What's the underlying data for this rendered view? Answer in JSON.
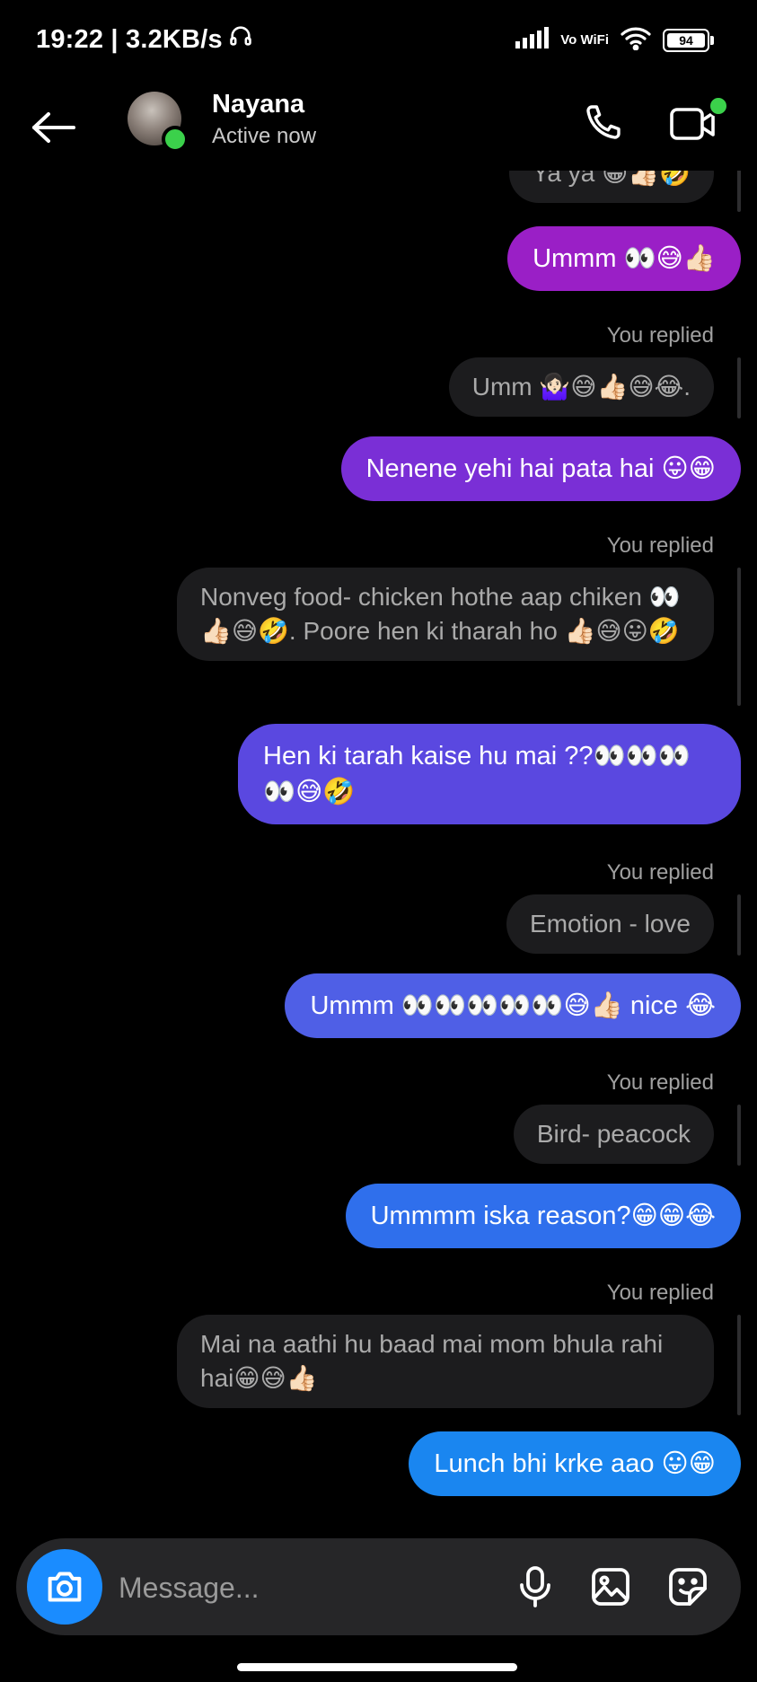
{
  "status_bar": {
    "time_speed": "19:22 | 3.2KB/s",
    "network_label": "Vo WiFi",
    "battery": "94"
  },
  "header": {
    "contact_name": "Nayana",
    "contact_status": "Active now"
  },
  "messages": [
    {
      "type": "quote",
      "text": "Ya ya 😁👍🏻🤣"
    },
    {
      "type": "sent",
      "text": "Ummm 👀😅👍🏻"
    },
    {
      "type": "label",
      "text": "You replied"
    },
    {
      "type": "quote",
      "text": "Umm 🤷🏻‍♀️😅👍🏻😅😂."
    },
    {
      "type": "sent",
      "text": "Nenene yehi hai pata hai 😛😁"
    },
    {
      "type": "label",
      "text": "You replied"
    },
    {
      "type": "quote",
      "text": "Nonveg  food- chicken hothe aap chiken 👀👍🏻😅🤣. Poore hen ki tharah ho 👍🏻😅😛🤣"
    },
    {
      "type": "sent",
      "text": "Hen ki tarah kaise hu mai ??👀👀👀👀😅🤣"
    },
    {
      "type": "label",
      "text": "You replied"
    },
    {
      "type": "quote",
      "text": "Emotion - love"
    },
    {
      "type": "sent",
      "text": "Ummm 👀👀👀👀👀😅👍🏻 nice 😂"
    },
    {
      "type": "label",
      "text": "You replied"
    },
    {
      "type": "quote",
      "text": "Bird- peacock"
    },
    {
      "type": "sent",
      "text": "Ummmm iska reason?😁😁😂"
    },
    {
      "type": "label",
      "text": "You replied"
    },
    {
      "type": "quote",
      "text": "Mai na aathi hu baad mai mom bhula rahi hai😁😅👍🏻"
    },
    {
      "type": "sent",
      "text": "Lunch bhi krke aao 😛😁"
    }
  ],
  "composer": {
    "placeholder": "Message..."
  },
  "colors": {
    "bubble_purple": "#9a1fc6",
    "bubble_violet": "#7a2fd6",
    "bubble_indigo": "#5a48e0",
    "bubble_blue_violet": "#4f5fe6",
    "bubble_blue": "#2f6fec",
    "bubble_sky": "#1a86f0",
    "quote_bg": "#1c1c1e",
    "online_green": "#3bd14b",
    "camera_blue": "#1a8cff"
  }
}
